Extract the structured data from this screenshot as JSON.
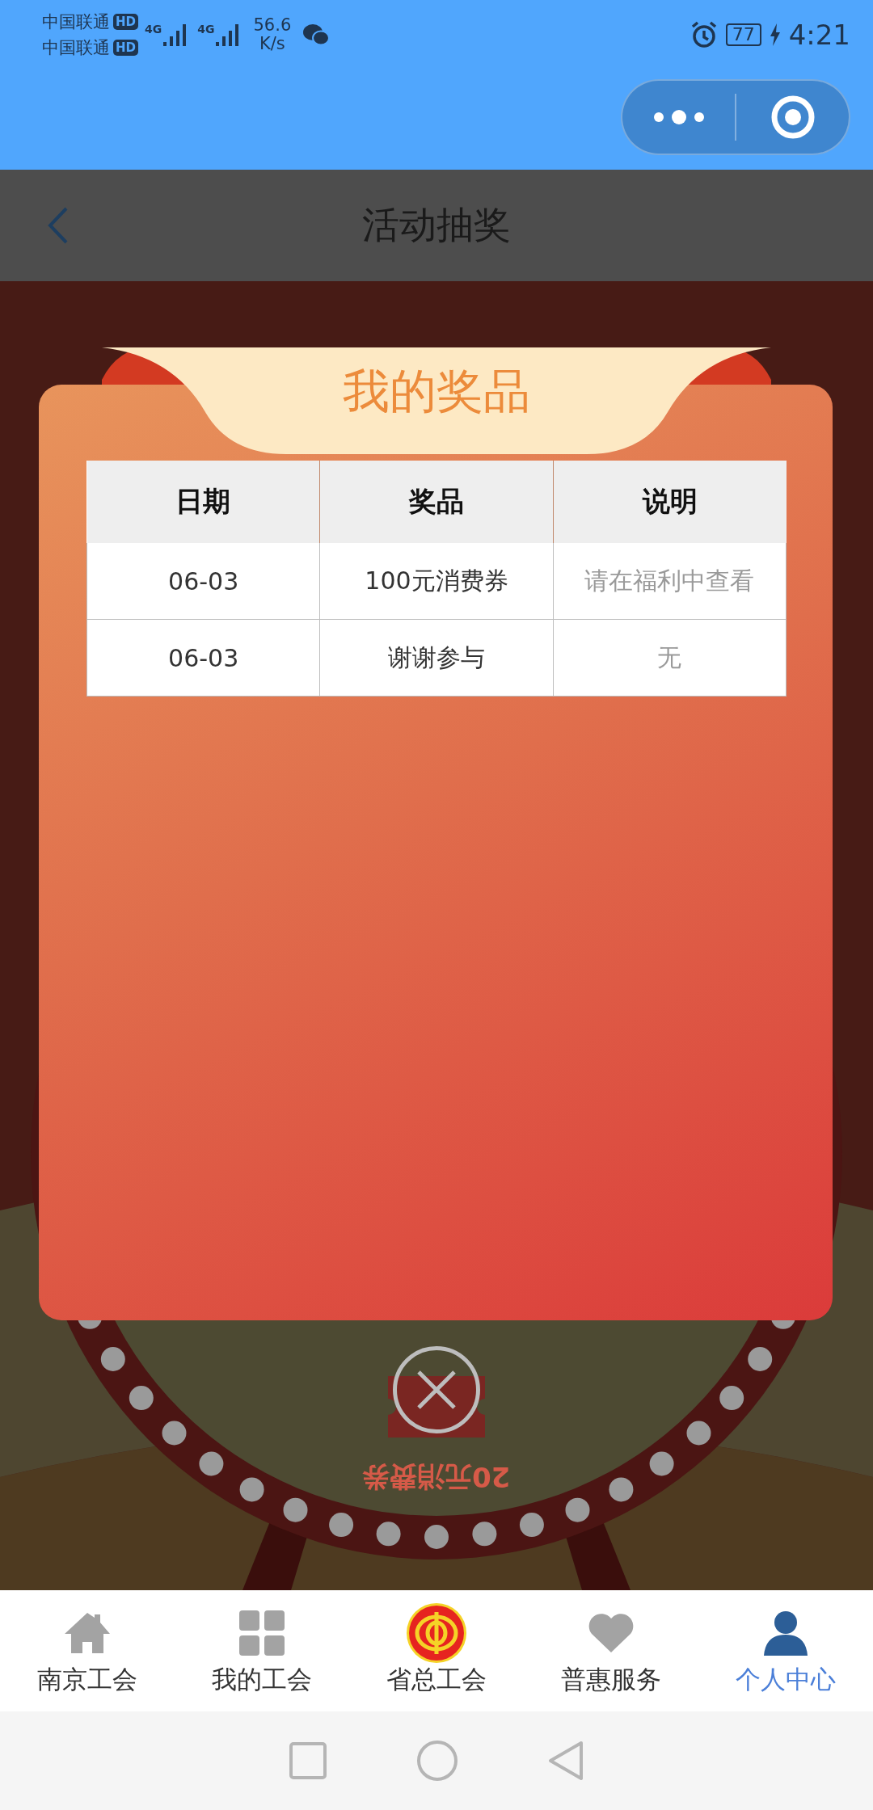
{
  "status_bar": {
    "carrier_1": "中国联通",
    "hd_1": "HD",
    "carrier_2": "中国联通",
    "hd_2": "HD",
    "network_1": "4G",
    "network_2": "4G",
    "speed": "56.6",
    "speed_unit": "K/s",
    "battery": "77",
    "time": "4:21"
  },
  "header": {
    "title": "活动抽奖"
  },
  "background": {
    "wheel_label": "20元消费券"
  },
  "modal": {
    "title": "我的奖品",
    "table": {
      "columns": [
        "日期",
        "奖品",
        "说明"
      ],
      "rows": [
        [
          "06-03",
          "100元消费券",
          "请在福利中查看"
        ],
        [
          "06-03",
          "谢谢参与",
          "无"
        ]
      ]
    }
  },
  "tab_bar": {
    "tabs": [
      {
        "label": "南京工会",
        "selected": false
      },
      {
        "label": "我的工会",
        "selected": false
      },
      {
        "label": "省总工会",
        "selected": false
      },
      {
        "label": "普惠服务",
        "selected": false
      },
      {
        "label": "个人中心",
        "selected": true
      }
    ]
  }
}
